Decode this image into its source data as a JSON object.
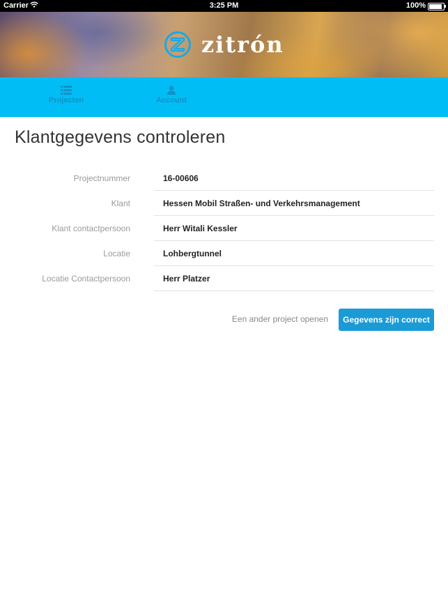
{
  "status_bar": {
    "carrier": "Carrier",
    "time": "3:25 PM",
    "battery": "100%",
    "battery_level": 1.0
  },
  "header": {
    "logo_text": "zitrón",
    "logo_color": "#1aa8e6"
  },
  "tabs": [
    {
      "label": "Projecten",
      "icon": "list-icon"
    },
    {
      "label": "Account",
      "icon": "person-icon"
    }
  ],
  "page": {
    "title": "Klantgegevens controleren"
  },
  "details": [
    {
      "label": "Projectnummer",
      "value": "16-00606"
    },
    {
      "label": "Klant",
      "value": "Hessen Mobil Straßen- und Verkehrsmanagement"
    },
    {
      "label": "Klant contactpersoon",
      "value": "Herr Witali Kessler"
    },
    {
      "label": "Locatie",
      "value": "Lohbergtunnel"
    },
    {
      "label": "Locatie Contactpersoon",
      "value": "Herr Platzer"
    }
  ],
  "actions": {
    "secondary_label": "Een ander project openen",
    "primary_label": "Gegevens zijn correct"
  },
  "colors": {
    "tabbar": "#00bdf5",
    "tab_text": "#1590c4",
    "primary_button": "#1a9bd6"
  }
}
